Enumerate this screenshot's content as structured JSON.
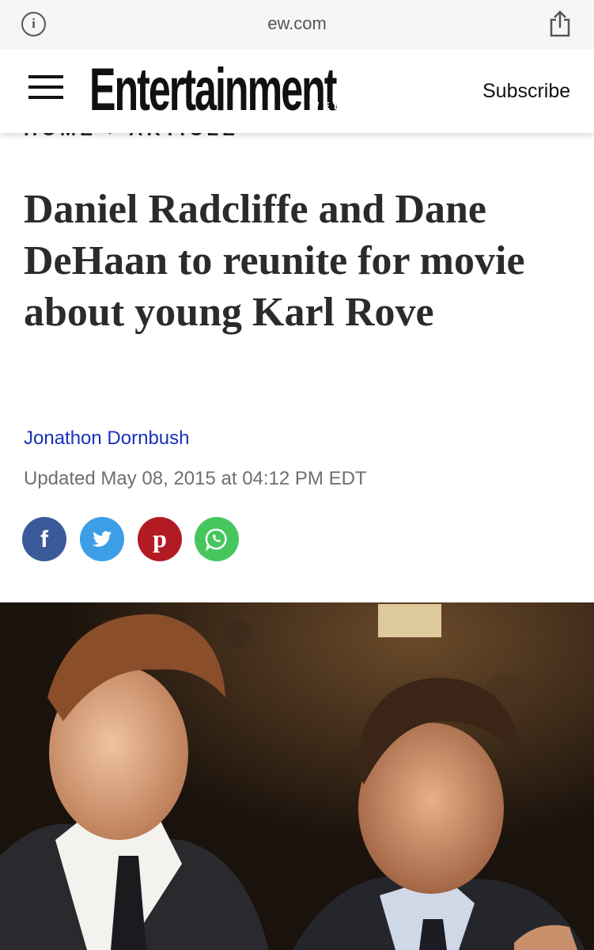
{
  "browser": {
    "url": "ew.com",
    "info_icon": "info-icon",
    "share_icon": "share-icon"
  },
  "header": {
    "menu_icon": "hamburger-menu-icon",
    "logo_text": "Entertainment",
    "logo_subtext": "WEEKLY",
    "subscribe_label": "Subscribe"
  },
  "breadcrumb": {
    "items": [
      "HOME",
      "ARTICLE"
    ]
  },
  "article": {
    "title": "Daniel Radcliffe and Dane DeHaan to reunite for movie about young Karl Rove",
    "author": "Jonathon Dornbush",
    "updated": "Updated May 08, 2015 at 04:12 PM EDT"
  },
  "share": {
    "buttons": [
      {
        "name": "facebook",
        "color": "#3b5a99",
        "glyph": "f"
      },
      {
        "name": "twitter",
        "color": "#3c9ee6"
      },
      {
        "name": "pinterest",
        "color": "#b31b24",
        "glyph": "p"
      },
      {
        "name": "whatsapp",
        "color": "#48c65e"
      }
    ]
  },
  "colors": {
    "author_link": "#1a31b8",
    "headline": "#2b2b2b",
    "breadcrumb_separator": "#2ea84a"
  }
}
